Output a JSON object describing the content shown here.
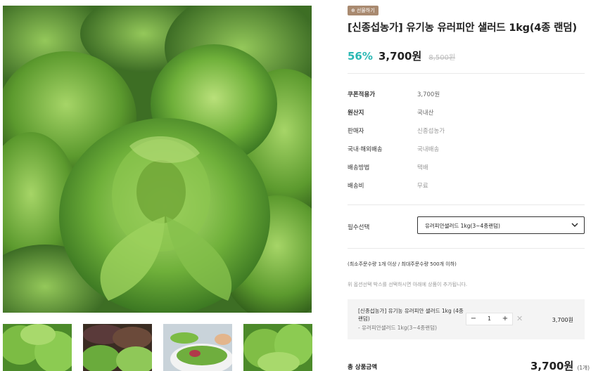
{
  "gallery": {
    "main_image": "romaine-lettuce-photo",
    "thumbnails": [
      "lettuce-thumb",
      "mixed-greens-thumb",
      "salad-bowl-thumb",
      "lettuce-thumb"
    ]
  },
  "product": {
    "badge_icon": "gift-icon",
    "badge_label": "선물하기",
    "title": "[신종섭농가] 유기농 유러피안 샐러드 1kg(4종 랜덤)",
    "discount": "56%",
    "price": "3,700원",
    "original_price": "8,500원",
    "specs": [
      {
        "key": "쿠폰적용가",
        "value": "3,700원"
      },
      {
        "key": "원산지",
        "value": "국내산"
      },
      {
        "key": "판매자",
        "value": "신종섭농가"
      },
      {
        "key": "국내·해외배송",
        "value": "국내배송"
      },
      {
        "key": "배송방법",
        "value": "택배"
      },
      {
        "key": "배송비",
        "value": "무료"
      }
    ]
  },
  "option": {
    "label": "필수선택",
    "selected": "유러피안샐러드 1kg(3~4종랜덤)"
  },
  "notes": {
    "order_limit": "(최소주문수량 1개 이상 / 최대주문수량 500개 이하)",
    "hint": "위 옵션선택 박스를 선택하시면 아래에 상품이 추가됩니다."
  },
  "selected_item": {
    "name": "[신종섭농가] 유기농 유러피안 샐러드 1kg (4종 랜덤)",
    "option": "- 유러피안샐러드 1kg(3~4종랜덤)",
    "quantity": "1",
    "minus": "−",
    "plus": "+",
    "remove": "✕",
    "price": "3,700원"
  },
  "total": {
    "label": "총 상품금액",
    "price": "3,700원",
    "count": "(1개)"
  },
  "colors": {
    "discount": "#2ab8b4",
    "badge": "#a98a70",
    "divider": "#e9e9e9",
    "selected_box": "#f4f4f4"
  }
}
